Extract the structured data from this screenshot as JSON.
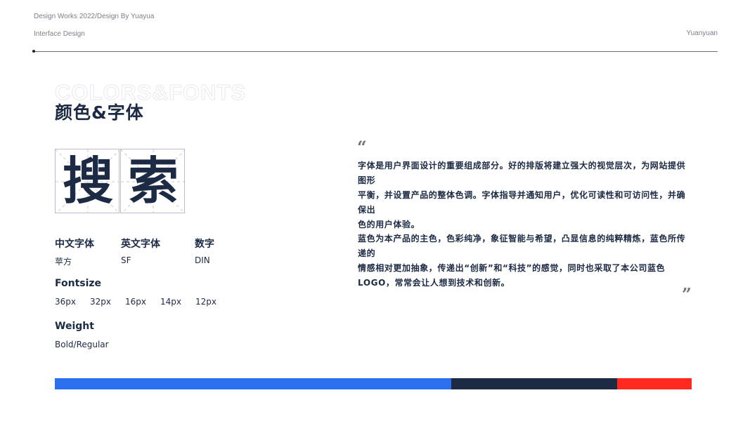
{
  "header": {
    "line1": "Design Works 2022/Design By Yuayua",
    "line2": "Interface Design",
    "author": "Yuanyuan"
  },
  "section": {
    "bg_title": "COLORS&FONTS",
    "title": "颜色&字体"
  },
  "sample": {
    "chars": [
      "搜",
      "索"
    ]
  },
  "fonts": {
    "items": [
      {
        "label": "中文字体",
        "value": "苹方"
      },
      {
        "label": "英文字体",
        "value": "SF"
      },
      {
        "label": "数字",
        "value": "DIN"
      }
    ],
    "fontsize_label": "Fontsize",
    "sizes": [
      "36px",
      "32px",
      "16px",
      "14px",
      "12px"
    ],
    "weight_label": "Weight",
    "weight_value": "Bold/Regular"
  },
  "description": {
    "open_quote": "“",
    "close_quote": "”",
    "para1_lines": [
      "字体是用户界面设计的重要组成部分。好的排版将建立强大的视觉层次，为网站提供图形",
      "平衡，并设置产品的整体色调。字体指导并通知用户，优化可读性和可访问性，并确保出",
      "色的用户体验。"
    ],
    "para2_lines": [
      "蓝色为本产品的主色，色彩纯净，象征智能与希望，凸显信息的纯粹精炼，蓝色所传递的",
      "情感相对更加抽象，传递出“创新”和“科技”的感觉，同时也采取了本公司蓝色",
      "LOGO，常常会让人想到技术和创新。"
    ]
  },
  "palette": {
    "colors": [
      {
        "hex": "#2b6fef",
        "share": 0.622
      },
      {
        "hex": "#1c2a44",
        "share": 0.261
      },
      {
        "hex": "#ff2a1f",
        "share": 0.117
      }
    ]
  }
}
